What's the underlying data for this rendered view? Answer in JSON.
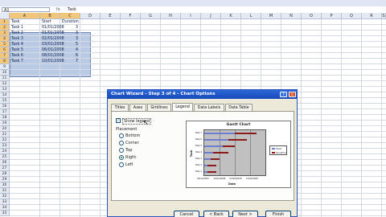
{
  "formula_bar": {
    "name_box": "A1",
    "fx": "fx",
    "value": "Task"
  },
  "columns": [
    "A",
    "B",
    "C",
    "D",
    "E",
    "F",
    "G",
    "H",
    "I",
    "J",
    "K",
    "L",
    "M",
    "N",
    "O",
    "P",
    "Q",
    "R",
    "S"
  ],
  "rows": [
    "1",
    "2",
    "3",
    "4",
    "5",
    "6",
    "7",
    "8",
    "9",
    "10",
    "11",
    "12",
    "13",
    "14",
    "15",
    "16",
    "17",
    "18",
    "19",
    "20",
    "21",
    "22",
    "23",
    "24",
    "25",
    "26",
    "27",
    "28",
    "29",
    "30",
    "31",
    "32",
    "33",
    "34",
    "35"
  ],
  "table": {
    "headers": [
      "Task",
      "Start",
      "Duration"
    ],
    "rows": [
      [
        "Task 1",
        "01/01/2008",
        "3"
      ],
      [
        "Task 2",
        "01/01/2008",
        "3"
      ],
      [
        "Task 3",
        "02/01/2008",
        "3"
      ],
      [
        "Task 4",
        "03/01/2008",
        "5"
      ],
      [
        "Task 5",
        "06/01/2008",
        "4"
      ],
      [
        "Task 6",
        "08/01/2008",
        "6"
      ],
      [
        "Task 7",
        "10/01/2008",
        "7"
      ]
    ]
  },
  "dialog": {
    "title": "Chart Wizard - Step 3 of 4 - Chart Options",
    "help": "?",
    "close": "x",
    "tabs": [
      "Titles",
      "Axes",
      "Gridlines",
      "Legend",
      "Data Labels",
      "Data Table"
    ],
    "active_tab": "Legend",
    "show_legend_label": "Show legend",
    "show_legend_checked": true,
    "check_mark": "✓",
    "placement_label": "Placement",
    "placement_options": [
      "Bottom",
      "Corner",
      "Top",
      "Right",
      "Left"
    ],
    "placement_selected": "Right",
    "buttons": {
      "cancel": "Cancel",
      "back": "< Back",
      "next": "Next >",
      "finish": "Finish"
    }
  },
  "chart_data": {
    "type": "bar",
    "title": "Gantt Chart",
    "xlabel": "Date",
    "ylabel": "Task",
    "categories": [
      "Task 7",
      "Task 6",
      "Task 5",
      "Task 4",
      "Task 3",
      "Task 2",
      "Task 1"
    ],
    "series": [
      {
        "name": "Start",
        "color": "#6f7fd0",
        "values": [
          10,
          8,
          6,
          3,
          2,
          1,
          1
        ]
      },
      {
        "name": "Duration",
        "color": "#8b1a1a",
        "values": [
          7,
          6,
          4,
          5,
          3,
          3,
          3
        ]
      }
    ],
    "x_ticks": [
      "25/12/2007",
      "14/01/2008",
      "03/02/2008",
      "23/02/2008"
    ],
    "xlim": [
      0,
      20
    ],
    "legend_position": "right",
    "horizontal": true,
    "stacked": true
  }
}
